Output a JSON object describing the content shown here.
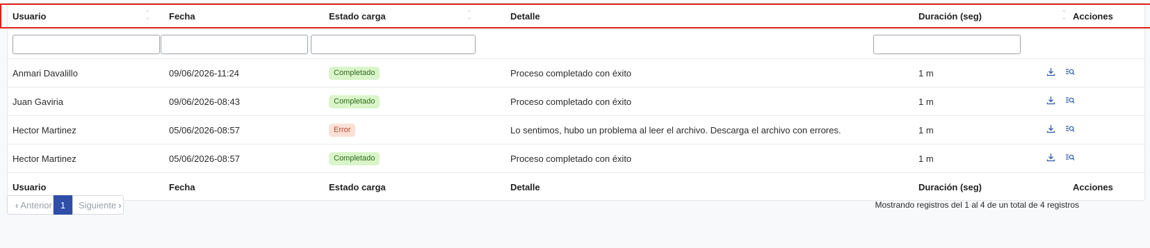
{
  "table": {
    "columns": {
      "usuario": "Usuario",
      "fecha": "Fecha",
      "estado": "Estado carga",
      "detalle": "Detalle",
      "duracion": "Duración (seg)",
      "acciones": "Acciones"
    },
    "filters": {
      "usuario": "",
      "fecha": "",
      "estado": "",
      "duracion": ""
    },
    "rows": [
      {
        "usuario": "Anmari Davalillo",
        "fecha": "09/06/2026-11:24",
        "estado": "Completado",
        "estado_type": "ok",
        "detalle": "Proceso completado con éxito",
        "duracion": "1 m"
      },
      {
        "usuario": "Juan Gaviria",
        "fecha": "09/06/2026-08:43",
        "estado": "Completado",
        "estado_type": "ok",
        "detalle": "Proceso completado con éxito",
        "duracion": "1 m"
      },
      {
        "usuario": "Hector Martinez",
        "fecha": "05/06/2026-08:57",
        "estado": "Error",
        "estado_type": "error",
        "detalle": "Lo sentimos, hubo un problema al leer el archivo. Descarga el archivo con errores.",
        "duracion": "1 m"
      },
      {
        "usuario": "Hector Martinez",
        "fecha": "05/06/2026-08:57",
        "estado": "Completado",
        "estado_type": "ok",
        "detalle": "Proceso completado con éxito",
        "duracion": "1 m"
      }
    ],
    "row_icons": [
      "download-icon",
      "search-list-icon"
    ]
  },
  "pagination": {
    "prev_label": "Anterior",
    "current_page": "1",
    "next_label": "Siguiente",
    "info": "Mostrando registros del 1 al 4 de un total de 4 registros"
  },
  "colors": {
    "accent": "#2e4ea8",
    "badge_ok_bg": "#d9f5c9",
    "badge_error_bg": "#fbe0d6",
    "highlight": "#e0201a"
  }
}
